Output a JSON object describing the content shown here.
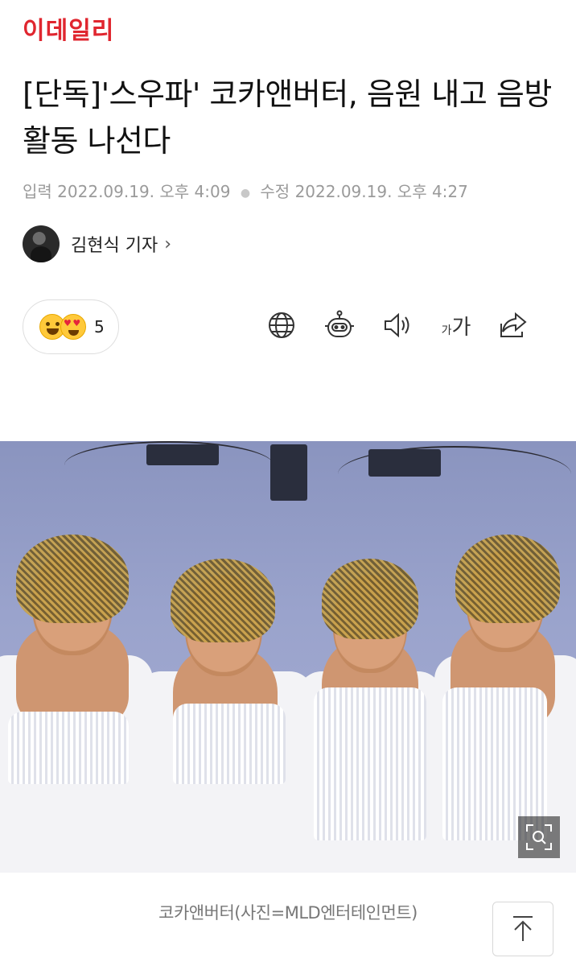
{
  "brand": {
    "logo_text": "이데일리",
    "accent_color": "#e0262f"
  },
  "article": {
    "title": "[단독]'스우파' 코카앤버터, 음원 내고 음방 활동 나선다",
    "published_label": "입력",
    "published": "2022.09.19. 오후 4:09",
    "modified_label": "수정",
    "modified": "2022.09.19. 오후 4:27",
    "author": "김현식 기자",
    "author_chevron": "›"
  },
  "reactions": {
    "emojis": [
      "grin-emoji",
      "heart-eyes-emoji"
    ],
    "count": "5"
  },
  "toolbar": {
    "icons": [
      "globe-icon",
      "robot-icon",
      "speaker-icon",
      "font-size-icon",
      "share-icon"
    ],
    "font_size_small": "가",
    "font_size_large": "가"
  },
  "photo": {
    "caption": "코카앤버터(사진=MLD엔터테인먼트)"
  }
}
